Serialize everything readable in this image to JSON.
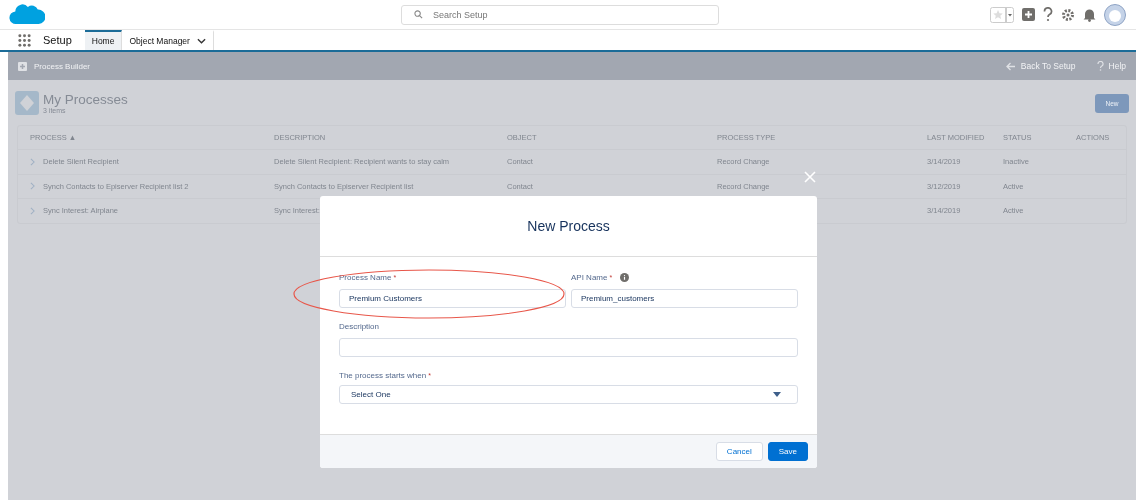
{
  "header": {
    "search": {
      "placeholder": "Search Setup"
    }
  },
  "nav": {
    "app_name": "Setup",
    "tabs": [
      {
        "label": "Home",
        "selected": true,
        "dropdown": false
      },
      {
        "label": "Object Manager",
        "selected": false,
        "dropdown": true
      }
    ]
  },
  "builder_bar": {
    "title": "Process Builder",
    "links": [
      "Back To Setup",
      "Help"
    ]
  },
  "page": {
    "title": "My Processes",
    "subtitle": "3 items",
    "new_button": "New"
  },
  "table": {
    "columns": [
      "PROCESS ▲",
      "DESCRIPTION",
      "OBJECT",
      "PROCESS TYPE",
      "LAST MODIFIED",
      "STATUS",
      "ACTIONS"
    ],
    "rows": [
      {
        "cells": [
          "Delete Silent Recipient",
          "Delete Silent Recipient: Recipient wants to stay calm",
          "Contact",
          "Record Change",
          "3/14/2019",
          "Inactive"
        ]
      },
      {
        "cells": [
          "Synch Contacts to Episerver Recipient list 2",
          "Synch Contacts to Episerver Recipient list",
          "Contact",
          "Record Change",
          "3/12/2019",
          "Active"
        ]
      },
      {
        "cells": [
          "Sync Interest: Airplane",
          "Sync Interest:",
          "",
          "",
          "3/14/2019",
          "Active"
        ]
      }
    ]
  },
  "modal": {
    "title": "New Process",
    "fields": [
      {
        "kind": "text",
        "label": "Process Name",
        "required_mark": "*",
        "info": false,
        "value": "Premium Customers",
        "highlighted": true
      },
      {
        "kind": "text",
        "label": "API Name",
        "required_mark": "*",
        "info": true,
        "value": "Premium_customers",
        "highlighted": false
      },
      {
        "kind": "text",
        "label": "Description",
        "info": false,
        "highlighted": false
      },
      {
        "kind": "select",
        "label": "The process starts when",
        "required_mark": "*",
        "info": false,
        "value": "Select One",
        "highlighted": false
      }
    ],
    "buttons": [
      {
        "label": "Cancel",
        "kind": "neutral"
      },
      {
        "label": "Save",
        "kind": "brand"
      }
    ]
  }
}
